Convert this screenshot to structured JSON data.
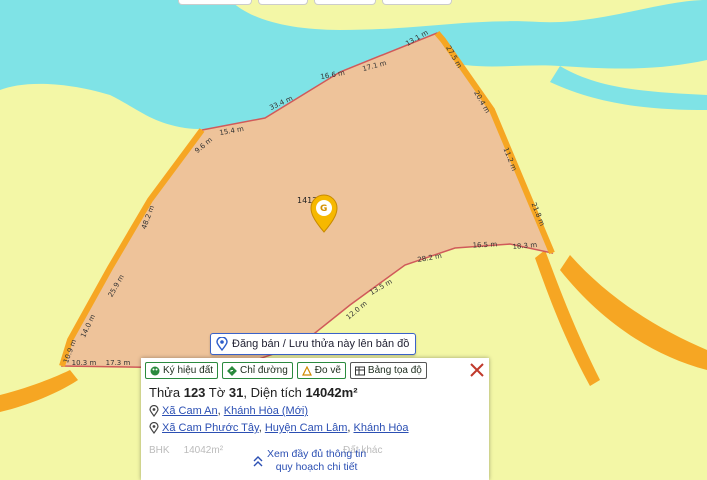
{
  "map": {
    "parcel_label": "1412",
    "segment_lengths": [
      "16.6 m",
      "17.1 m",
      "13.1 m",
      "27.5 m",
      "20.4 m",
      "11.2 m",
      "21.8 m",
      "18.3 m",
      "16.5 m",
      "28.2 m",
      "13.5 m",
      "12.0 m",
      "17.3 m",
      "10.3 m",
      "10.9 m",
      "14.0 m",
      "25.9 m",
      "48.2 m",
      "9.6 m",
      "15.4 m",
      "33.4 m"
    ],
    "colors": {
      "land": "#f3f7a6",
      "river": "#7fe3e6",
      "road": "#f6a623",
      "parcel": "#eec39a",
      "boundary": "#d05a5a"
    }
  },
  "post_button": {
    "label": "Đăng bán / Lưu thửa này lên bản đồ",
    "icon": "map-pin-icon"
  },
  "panel": {
    "tabs": [
      {
        "label": "Ký hiệu đất",
        "icon": "palette-icon"
      },
      {
        "label": "Chỉ đường",
        "icon": "directions-icon"
      },
      {
        "label": "Đo vẽ",
        "icon": "measure-icon"
      },
      {
        "label": "Bảng tọa độ",
        "icon": "table-icon"
      }
    ],
    "title": {
      "prefix": "Thửa ",
      "parcel": "123",
      "sheet_label": " Tờ ",
      "sheet": "31",
      "area_label": ", Diện tích ",
      "area": "14042m²"
    },
    "address_new": {
      "ward": "Xã Cam An",
      "sep": ", ",
      "province": "Khánh Hòa (Mới)"
    },
    "address_old": {
      "ward": "Xã Cam Phước Tây",
      "sep1": ", ",
      "district": "Huyện Cam Lâm",
      "sep2": ", ",
      "province": "Khánh Hòa"
    },
    "faded": {
      "code": "BHK",
      "area": "14042m²",
      "extra": "Đất khác"
    },
    "more_link": {
      "line1": "Xem đầy đủ thông tin",
      "line2": "quy hoạch chi tiết"
    }
  }
}
